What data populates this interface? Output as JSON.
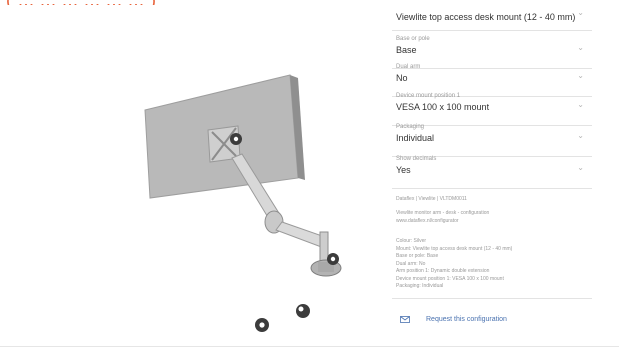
{
  "banner": {
    "text": "( ... ... ... ... ... ... )"
  },
  "configurator": {
    "rows": [
      {
        "label": "",
        "value": "Viewlite top access desk mount (12 - 40 mm)"
      },
      {
        "label": "Base or pole",
        "value": "Base"
      },
      {
        "label": "Dual arm",
        "value": "No"
      },
      {
        "label": "Device mount position 1",
        "value": "VESA 100 x 100 mount"
      },
      {
        "label": "Packaging",
        "value": "Individual"
      },
      {
        "label": "Show decimals",
        "value": "Yes"
      }
    ],
    "summary": {
      "code": "Dataflex | Viewlite | VLTDM0011",
      "description": [
        "Viewlite monitor arm - desk - configuration",
        "www.dataflex.nl/configurator"
      ],
      "details": [
        "Colour: Silver",
        "Mount: Viewlite top access desk mount (12 - 40 mm)",
        "Base or pole: Base",
        "Dual arm: No",
        "Arm position 1: Dynamic double extension",
        "Device mount position 1: VESA 100 x 100 mount",
        "Packaging: Individual"
      ]
    },
    "request_label": "Request this configuration"
  },
  "colors": {
    "accent": "#4a72b0",
    "banner": "#e8623a",
    "monitor": "#b9b9b9",
    "arm": "#d6d6d6"
  },
  "icons": {
    "chevron": "chevron-down-icon",
    "envelope": "envelope-icon",
    "hotspot": "gear-icon"
  }
}
